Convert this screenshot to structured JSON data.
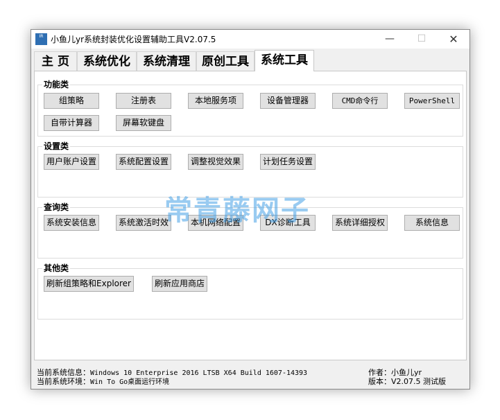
{
  "window": {
    "title": "小鱼儿yr系统封装优化设置辅助工具V2.07.5",
    "icon_text": "IR",
    "minimize": "—",
    "maximize": "☐",
    "close": "✕"
  },
  "tabs": [
    {
      "label": "主 页"
    },
    {
      "label": "系统优化"
    },
    {
      "label": "系统清理"
    },
    {
      "label": "原创工具"
    },
    {
      "label": "系统工具"
    }
  ],
  "groups": {
    "functions": {
      "title": "功能类",
      "buttons": [
        "组策略",
        "注册表",
        "本地服务项",
        "设备管理器",
        "CMD命令行",
        "PowerShell",
        "自带计算器",
        "屏幕软键盘"
      ]
    },
    "settings": {
      "title": "设置类",
      "buttons": [
        "用户账户设置",
        "系统配置设置",
        "调整视觉效果",
        "计划任务设置"
      ]
    },
    "query": {
      "title": "查询类",
      "buttons": [
        "系统安装信息",
        "系统激活时效",
        "本机网络配置",
        "DX诊断工具",
        "系统详细授权",
        "系统信息"
      ]
    },
    "others": {
      "title": "其他类",
      "buttons": [
        "刷新组策略和Explorer",
        "刷新应用商店"
      ]
    }
  },
  "status": {
    "sysinfo_label": "当前系统信息：",
    "sysinfo_value": "Windows 10 Enterprise 2016 LTSB X64 Build 1607-14393",
    "env_label": "当前系统环境：",
    "env_value": "Win To Go桌面运行环境",
    "author_label": "作者：",
    "author_value": "小鱼儿yr",
    "version_label": "版本：",
    "version_value": "V2.07.5 测试版"
  },
  "watermark": "常青藤网子"
}
